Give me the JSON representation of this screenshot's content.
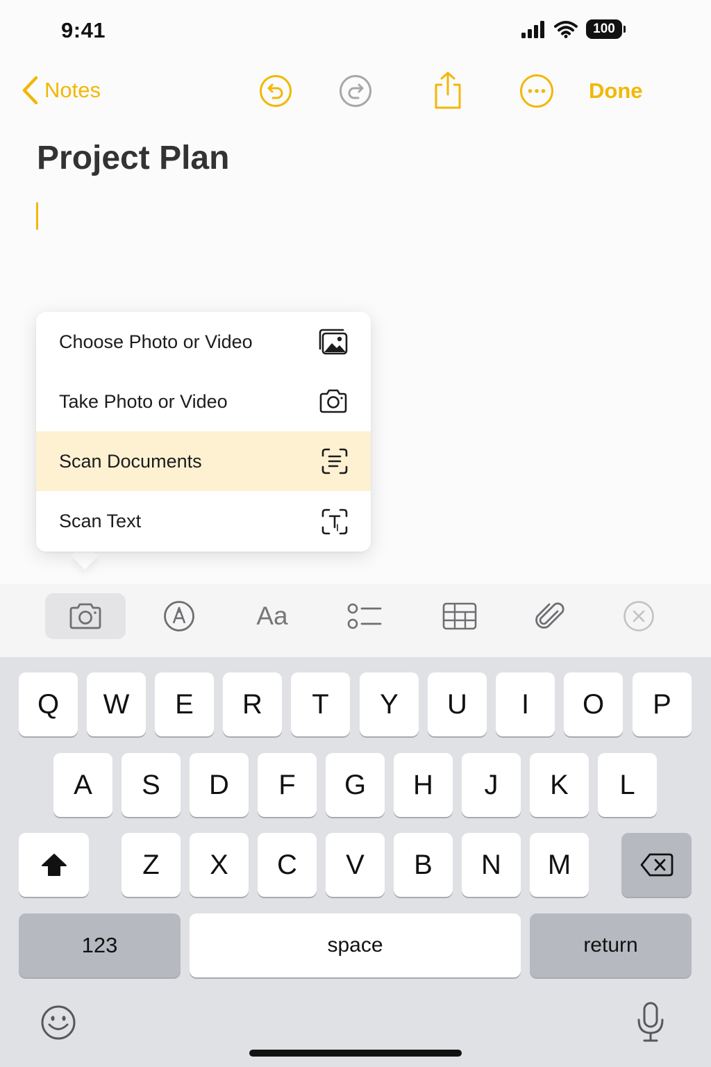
{
  "status_bar": {
    "time": "9:41",
    "battery": "100"
  },
  "nav": {
    "back_label": "Notes",
    "done_label": "Done"
  },
  "note": {
    "title": "Project Plan"
  },
  "attach_menu": {
    "items": [
      {
        "label": "Choose Photo or Video",
        "icon": "photo-library-icon"
      },
      {
        "label": "Take Photo or Video",
        "icon": "camera-icon"
      },
      {
        "label": "Scan Documents",
        "icon": "scan-document-icon",
        "highlighted": true
      },
      {
        "label": "Scan Text",
        "icon": "scan-text-icon"
      }
    ]
  },
  "toolbar": {
    "format_label": "Aa",
    "tools": [
      "camera-icon",
      "markup-icon",
      "text-format",
      "checklist-icon",
      "table-icon",
      "attachment-icon",
      "close-icon"
    ],
    "active_tool": "camera-icon"
  },
  "keyboard": {
    "row1": [
      "Q",
      "W",
      "E",
      "R",
      "T",
      "Y",
      "U",
      "I",
      "O",
      "P"
    ],
    "row2": [
      "A",
      "S",
      "D",
      "F",
      "G",
      "H",
      "J",
      "K",
      "L"
    ],
    "row3": [
      "Z",
      "X",
      "C",
      "V",
      "B",
      "N",
      "M"
    ],
    "numbers_label": "123",
    "space_label": "space",
    "return_label": "return"
  },
  "colors": {
    "accent": "#f2b705",
    "menu_highlight": "#fdf1d2",
    "keyboard_bg": "#e0e1e5"
  }
}
